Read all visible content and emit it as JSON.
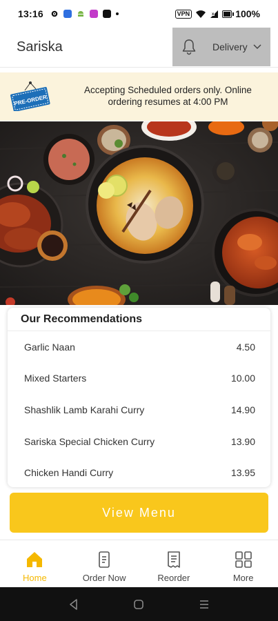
{
  "status_bar": {
    "time": "13:16",
    "vpn_label": "VPN",
    "battery_text": "100%"
  },
  "header": {
    "title": "Sariska",
    "delivery_label": "Delivery",
    "bell_icon": "bell-icon"
  },
  "banner": {
    "tag_text": "PRE-ORDER",
    "message": "Accepting Scheduled orders only. Online ordering resumes at 4:00 PM"
  },
  "recommendations": {
    "title": "Our Recommendations",
    "items": [
      {
        "name": "Garlic Naan",
        "price": "4.50"
      },
      {
        "name": "Mixed Starters",
        "price": "10.00"
      },
      {
        "name": "Shashlik Lamb Karahi Curry",
        "price": "14.90"
      },
      {
        "name": "Sariska Special Chicken Curry",
        "price": "13.90"
      },
      {
        "name": "Chicken Handi Curry",
        "price": "13.95"
      }
    ]
  },
  "view_menu_label": "View Menu",
  "bottom_nav": {
    "items": [
      {
        "label": "Home",
        "icon": "home-icon",
        "active": true
      },
      {
        "label": "Order Now",
        "icon": "order-icon",
        "active": false
      },
      {
        "label": "Reorder",
        "icon": "receipt-icon",
        "active": false
      },
      {
        "label": "More",
        "icon": "grid-icon",
        "active": false
      }
    ]
  },
  "colors": {
    "accent": "#f9c71c",
    "active_nav": "#f5b800",
    "banner_bg": "#fbf3dc",
    "delivery_box_bg": "#bdbdbd"
  }
}
